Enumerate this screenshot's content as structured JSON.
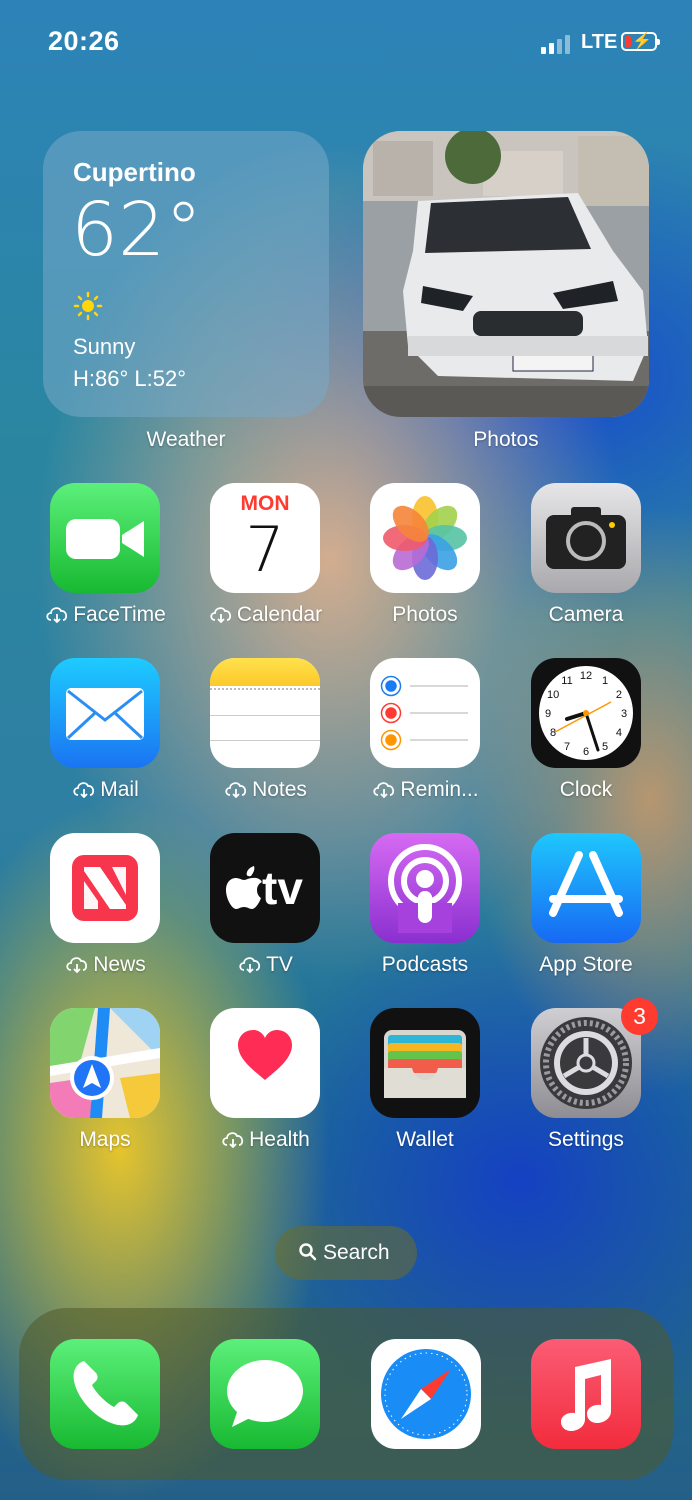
{
  "status_bar": {
    "time": "20:26",
    "network": "LTE",
    "battery_color": "#ff3b30"
  },
  "widgets": {
    "weather": {
      "city": "Cupertino",
      "temperature": "62°",
      "condition": "Sunny",
      "high_low": "H:86° L:52°",
      "label": "Weather"
    },
    "photos": {
      "label": "Photos"
    }
  },
  "apps": {
    "facetime": "FaceTime",
    "calendar": {
      "label": "Calendar",
      "day": "MON",
      "date": "7"
    },
    "photos": "Photos",
    "camera": "Camera",
    "mail": "Mail",
    "notes": "Notes",
    "reminders": "Remin...",
    "clock": "Clock",
    "news": "News",
    "tv": {
      "label": "TV",
      "logo_text": "tv"
    },
    "podcasts": "Podcasts",
    "app_store": "App Store",
    "maps": "Maps",
    "health": "Health",
    "wallet": "Wallet",
    "settings": {
      "label": "Settings",
      "badge": "3"
    }
  },
  "clock_numbers": [
    "12",
    "1",
    "2",
    "3",
    "4",
    "5",
    "6",
    "7",
    "8",
    "9",
    "10",
    "11"
  ],
  "search": {
    "label": "Search"
  },
  "dock": [
    "phone-icon",
    "messages-icon",
    "safari-icon",
    "music-icon"
  ]
}
